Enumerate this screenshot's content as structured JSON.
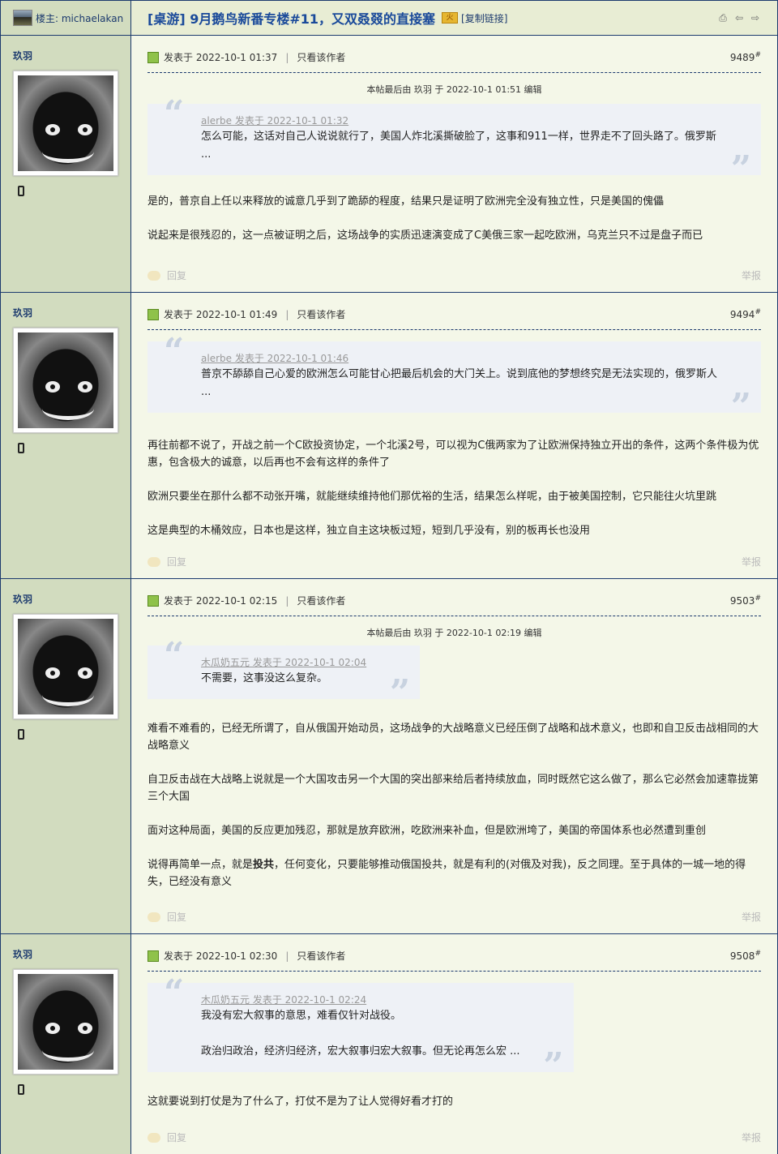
{
  "header": {
    "owner_label": "楼主: michaelakan",
    "title": "[桌游] 9月鹅鸟新番专楼#11，又双叒叕的直接塞",
    "badge": "火",
    "copy_link": "[复制链接]"
  },
  "posts": [
    {
      "author": "玖羽",
      "time": "发表于 2022-10-1 01:37",
      "only_author": "只看该作者",
      "floor": "9489",
      "edit_note": "本帖最后由 玖羽 于 2022-10-1 01:51 编辑",
      "quote_head": "alerbe 发表于 2022-10-1 01:32",
      "quote_text": "怎么可能，这话对自己人说说就行了，美国人炸北溪撕破脸了，这事和911一样，世界走不了回头路了。俄罗斯 ...",
      "body": [
        "是的，普京自上任以来释放的诚意几乎到了跪舔的程度，结果只是证明了欧洲完全没有独立性，只是美国的傀儡",
        "说起来是很残忍的，这一点被证明之后，这场战争的实质迅速演变成了C美俄三家一起吃欧洲，乌克兰只不过是盘子而已"
      ],
      "reply": "回复",
      "report": "举报"
    },
    {
      "author": "玖羽",
      "time": "发表于 2022-10-1 01:49",
      "only_author": "只看该作者",
      "floor": "9494",
      "edit_note": "",
      "quote_head": "alerbe 发表于 2022-10-1 01:46",
      "quote_text": "普京不舔舔自己心爱的欧洲怎么可能甘心把最后机会的大门关上。说到底他的梦想终究是无法实现的，俄罗斯人 ...",
      "body": [
        "再往前都不说了，开战之前一个C欧投资协定，一个北溪2号，可以视为C俄两家为了让欧洲保持独立开出的条件，这两个条件极为优惠，包含极大的诚意，以后再也不会有这样的条件了",
        "欧洲只要坐在那什么都不动张开嘴，就能继续维持他们那优裕的生活，结果怎么样呢，由于被美国控制，它只能往火坑里跳",
        "这是典型的木桶效应，日本也是这样，独立自主这块板过短，短到几乎没有，别的板再长也没用"
      ],
      "reply": "回复",
      "report": "举报"
    },
    {
      "author": "玖羽",
      "time": "发表于 2022-10-1 02:15",
      "only_author": "只看该作者",
      "floor": "9503",
      "edit_note": "本帖最后由 玖羽 于 2022-10-1 02:19 编辑",
      "quote_head": "木瓜奶五元 发表于 2022-10-1 02:04",
      "quote_text": "不需要，这事没这么复杂。",
      "body": [
        "难看不难看的，已经无所谓了，自从俄国开始动员，这场战争的大战略意义已经压倒了战略和战术意义，也即和自卫反击战相同的大战略意义",
        "自卫反击战在大战略上说就是一个大国攻击另一个大国的突出部来给后者持续放血，同时既然它这么做了，那么它必然会加速靠拢第三个大国",
        "面对这种局面，美国的反应更加残忍，那就是放弃欧洲，吃欧洲来补血，但是欧洲垮了，美国的帝国体系也必然遭到重创"
      ],
      "body_last_pre": "说得再简单一点，就是",
      "body_last_bold": "投共",
      "body_last_post": "，任何变化，只要能够推动俄国投共，就是有利的(对俄及对我)，反之同理。至于具体的一城一地的得失，已经没有意义",
      "reply": "回复",
      "report": "举报"
    },
    {
      "author": "玖羽",
      "time": "发表于 2022-10-1 02:30",
      "only_author": "只看该作者",
      "floor": "9508",
      "edit_note": "",
      "quote_head": "木瓜奶五元 发表于 2022-10-1 02:24",
      "quote_text": "我没有宏大叙事的意思，难看仅针对战役。",
      "quote_text2": "政治归政治，经济归经济，宏大叙事归宏大叙事。但无论再怎么宏 ...",
      "body": [
        "这就要说到打仗是为了什么了，打仗不是为了让人觉得好看才打的"
      ],
      "reply": "回复",
      "report": "举报"
    }
  ]
}
